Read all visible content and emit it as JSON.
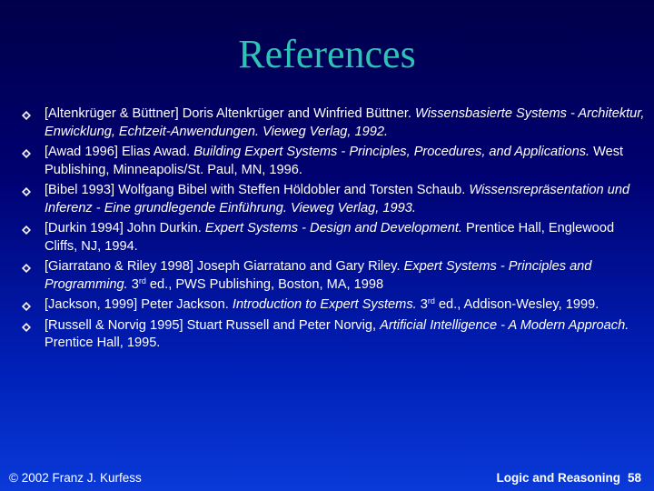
{
  "title": "References",
  "bullet_icon": "diamond-bullet",
  "bullet_color": "#ffffff",
  "title_color": "#2fc3b5",
  "references": [
    {
      "key": "[Altenkrüger & Büttner]",
      "authors": "Doris Altenkrüger and Winfried Büttner.",
      "title": "Wissensbasierte Systems - Architektur, Enwicklung, Echtzeit-Anwendungen. Vieweg Verlag, 1992.",
      "publication": ""
    },
    {
      "key": "[Awad 1996]",
      "authors": "Elias Awad.",
      "title": "Building Expert Systems - Principles, Procedures, and Applications.",
      "publication": "West Publishing, Minneapolis/St. Paul, MN, 1996."
    },
    {
      "key": "[Bibel 1993]",
      "authors": "Wolfgang Bibel with Steffen Höldobler and Torsten Schaub.",
      "title": "Wissensrepräsentation und Inferenz - Eine grundlegende Einführung. Vieweg Verlag, 1993.",
      "publication": ""
    },
    {
      "key": "[Durkin 1994]",
      "authors": "John Durkin.",
      "title": "Expert Systems - Design and Development.",
      "publication": "Prentice Hall, Englewood Cliffs, NJ, 1994."
    },
    {
      "key": "[Giarratano & Riley 1998]",
      "authors": "Joseph Giarratano and Gary Riley.",
      "title": "Expert Systems - Principles and Programming.",
      "edition_num": "3",
      "edition_sup": "rd",
      "publication": "ed., PWS Publishing, Boston, MA, 1998"
    },
    {
      "key": "[Jackson, 1999]",
      "authors": "Peter Jackson.",
      "title": "Introduction to Expert Systems.",
      "edition_num": "3",
      "edition_sup": "rd",
      "publication": "ed., Addison-Wesley, 1999."
    },
    {
      "key": "[Russell & Norvig 1995]",
      "authors": "Stuart Russell and Peter Norvig,",
      "title": "Artificial Intelligence - A Modern Approach.",
      "publication": "Prentice Hall, 1995."
    }
  ],
  "footer": {
    "copyright": "© 2002 Franz J. Kurfess",
    "course": "Logic and Reasoning",
    "page_number": "58"
  }
}
